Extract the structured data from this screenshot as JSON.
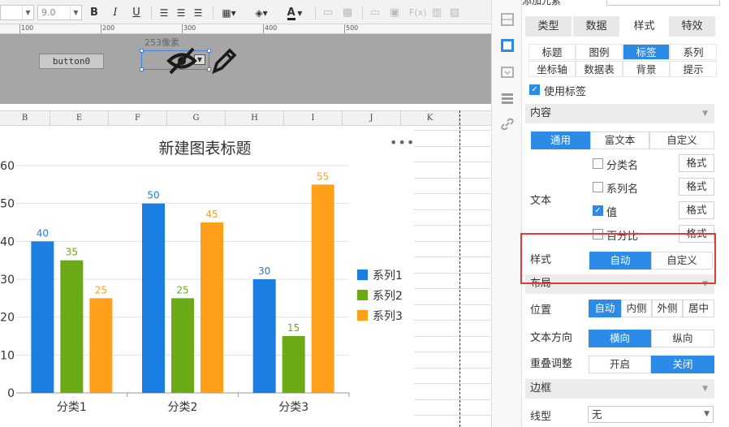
{
  "toolbar": {
    "font_name_value": "",
    "font_size_value": "9.0",
    "bold": "B",
    "italic": "I",
    "underline": "U",
    "font_color_letter": "A"
  },
  "ruler": {
    "labels": [
      "100",
      "200",
      "300",
      "400",
      "500"
    ]
  },
  "form": {
    "button0_label": "button0",
    "selection_size_label": "253像素"
  },
  "columns": [
    "B",
    "E",
    "F",
    "G",
    "H",
    "I",
    "J",
    "K"
  ],
  "chart_data": {
    "type": "bar",
    "title": "新建图表标题",
    "categories": [
      "分类1",
      "分类2",
      "分类3"
    ],
    "series": [
      {
        "name": "系列1",
        "color": "#1a7fe0",
        "values": [
          40,
          50,
          30
        ]
      },
      {
        "name": "系列2",
        "color": "#6aaa16",
        "values": [
          35,
          25,
          15
        ]
      },
      {
        "name": "系列3",
        "color": "#ff9f1a",
        "values": [
          25,
          45,
          55
        ]
      }
    ],
    "y_ticks": [
      "0",
      "10",
      "20",
      "30",
      "40",
      "50",
      "60"
    ],
    "ylim": [
      0,
      60
    ],
    "grid": true,
    "legend_position": "right",
    "data_labels": true,
    "more_icon": "•••"
  },
  "panel": {
    "top_label": "添加元素",
    "tabs": [
      {
        "label": "类型",
        "active": false
      },
      {
        "label": "数据",
        "active": false
      },
      {
        "label": "样式",
        "active": true
      },
      {
        "label": "特效",
        "active": false
      }
    ],
    "subtabs_row1": [
      {
        "label": "标题",
        "active": false
      },
      {
        "label": "图例",
        "active": false
      },
      {
        "label": "标签",
        "active": true
      },
      {
        "label": "系列",
        "active": false
      }
    ],
    "subtabs_row2": [
      {
        "label": "坐标轴",
        "active": false
      },
      {
        "label": "数据表",
        "active": false
      },
      {
        "label": "背景",
        "active": false
      },
      {
        "label": "提示",
        "active": false
      }
    ],
    "use_label_text": "使用标签",
    "content_section": "内容",
    "content_modes": [
      {
        "label": "通用",
        "active": true
      },
      {
        "label": "富文本",
        "active": false
      },
      {
        "label": "自定义",
        "active": false
      }
    ],
    "text_label": "文本",
    "text_options": [
      {
        "label": "分类名",
        "checked": false,
        "format": "格式"
      },
      {
        "label": "系列名",
        "checked": false,
        "format": "格式"
      },
      {
        "label": "值",
        "checked": true,
        "format": "格式"
      },
      {
        "label": "百分比",
        "checked": false,
        "format": "格式"
      }
    ],
    "style_label": "样式",
    "style_modes": [
      {
        "label": "自动",
        "active": true
      },
      {
        "label": "自定义",
        "active": false
      }
    ],
    "layout_section": "布局",
    "position_label": "位置",
    "position_modes": [
      {
        "label": "自动",
        "active": true
      },
      {
        "label": "内侧",
        "active": false
      },
      {
        "label": "外侧",
        "active": false
      },
      {
        "label": "居中",
        "active": false
      }
    ],
    "direction_label": "文本方向",
    "direction_modes": [
      {
        "label": "横向",
        "active": true
      },
      {
        "label": "纵向",
        "active": false
      }
    ],
    "overlap_label": "重叠调整",
    "overlap_modes": [
      {
        "label": "开启",
        "active": false
      },
      {
        "label": "关闭",
        "active": true
      }
    ],
    "border_section": "边框",
    "line_type_label": "线型",
    "line_type_value": "无"
  }
}
